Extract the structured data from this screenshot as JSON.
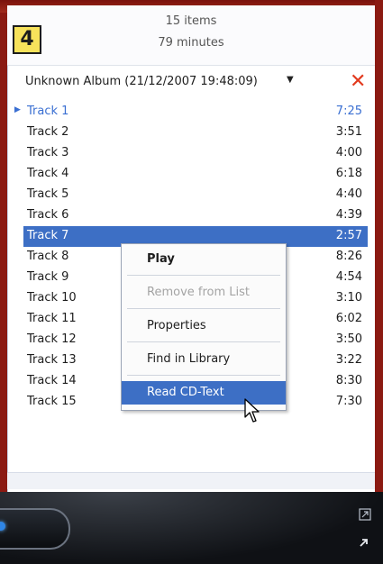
{
  "header": {
    "items_count": "15 items",
    "minutes": "79 minutes",
    "step_badge": "4"
  },
  "album": {
    "title": "Unknown Album (21/12/2007 19:48:09)",
    "dropdown_caret": "▼",
    "close_symbol": "✕"
  },
  "tracks": [
    {
      "name": "Track 1",
      "duration": "7:25"
    },
    {
      "name": "Track 2",
      "duration": "3:51"
    },
    {
      "name": "Track 3",
      "duration": "4:00"
    },
    {
      "name": "Track 4",
      "duration": "6:18"
    },
    {
      "name": "Track 5",
      "duration": "4:40"
    },
    {
      "name": "Track 6",
      "duration": "4:39"
    },
    {
      "name": "Track 7",
      "duration": "2:57"
    },
    {
      "name": "Track 8",
      "duration": "8:26"
    },
    {
      "name": "Track 9",
      "duration": "4:54"
    },
    {
      "name": "Track 10",
      "duration": "3:10"
    },
    {
      "name": "Track 11",
      "duration": "6:02"
    },
    {
      "name": "Track 12",
      "duration": "3:50"
    },
    {
      "name": "Track 13",
      "duration": "3:22"
    },
    {
      "name": "Track 14",
      "duration": "8:30"
    },
    {
      "name": "Track 15",
      "duration": "7:30"
    }
  ],
  "now_playing_index": 0,
  "selected_index": 6,
  "context_menu": {
    "items": [
      {
        "label": "Play",
        "bold": true,
        "enabled": true
      },
      {
        "label": "Remove from List",
        "bold": false,
        "enabled": false
      },
      {
        "label": "Properties",
        "bold": false,
        "enabled": true
      },
      {
        "label": "Find in Library",
        "bold": false,
        "enabled": true
      },
      {
        "label": "Read CD-Text",
        "bold": false,
        "enabled": true,
        "highlighted": true
      }
    ]
  },
  "colors": {
    "accent": "#3d6fc5",
    "playing": "#3a6fd2",
    "frame": "#8b1a12",
    "close": "#e23a1e"
  }
}
